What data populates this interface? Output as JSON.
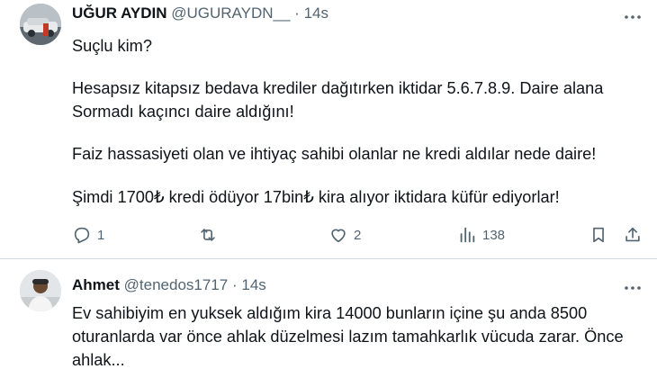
{
  "tweets": [
    {
      "author": "UĞUR AYDIN",
      "handle": "@UGURAYDN__",
      "separator": "·",
      "time": "14s",
      "lines": [
        "Suçlu kim?",
        "Hesapsız kitapsız bedava krediler dağıtırken iktidar 5.6.7.8.9. Daire alana",
        "Sormadı kaçıncı daire aldığını!",
        "Faiz hassasiyeti olan ve ihtiyaç sahibi olanlar ne kredi aldılar nede daire!",
        "Şimdi 1700₺ kredi ödüyor 17bin₺ kira alıyor iktidara küfür ediyorlar!"
      ],
      "replies": "1",
      "retweets": "",
      "likes": "2",
      "views": "138"
    },
    {
      "author": "Ahmet",
      "handle": "@tenedos1717",
      "separator": "·",
      "time": "14s",
      "lines": [
        "Ev sahibiyim en yuksek aldığım kira 14000 bunların içine şu anda 8500",
        "oturanlarda var önce ahlak düzelmesi lazım tamahkarlık vücuda zarar. Önce",
        "ahlak..."
      ]
    }
  ],
  "icons": {
    "reply": "reply-icon",
    "retweet": "retweet-icon",
    "like": "heart-icon",
    "views": "views-icon",
    "bookmark": "bookmark-icon",
    "share": "share-icon",
    "more": "more-icon"
  },
  "colors": {
    "text": "#0f1419",
    "secondary": "#536471",
    "divider": "#cfd9de"
  }
}
